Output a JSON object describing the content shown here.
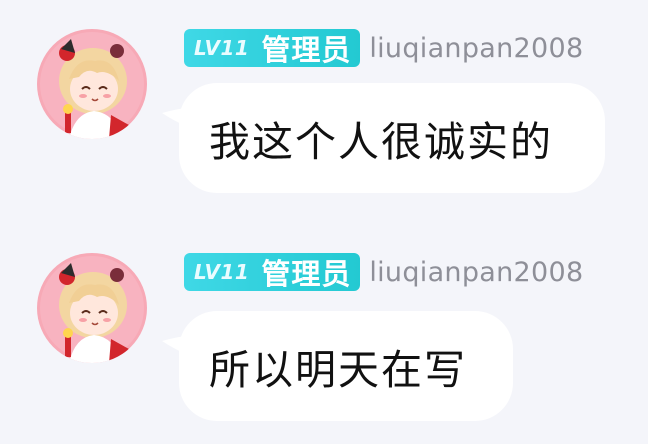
{
  "messages": [
    {
      "badge": {
        "level": "LV11",
        "role": "管理员",
        "color": "#2ccfd9"
      },
      "username": "liuqianpan2008",
      "text": "我这个人很诚实的"
    },
    {
      "badge": {
        "level": "LV11",
        "role": "管理员",
        "color": "#2ccfd9"
      },
      "username": "liuqianpan2008",
      "text": "所以明天在写"
    }
  ],
  "colors": {
    "background": "#f4f5fa",
    "bubble": "#ffffff",
    "username": "#8e8f98",
    "message_text": "#111111"
  },
  "icons": {
    "avatar": "anime-girl-avatar"
  }
}
